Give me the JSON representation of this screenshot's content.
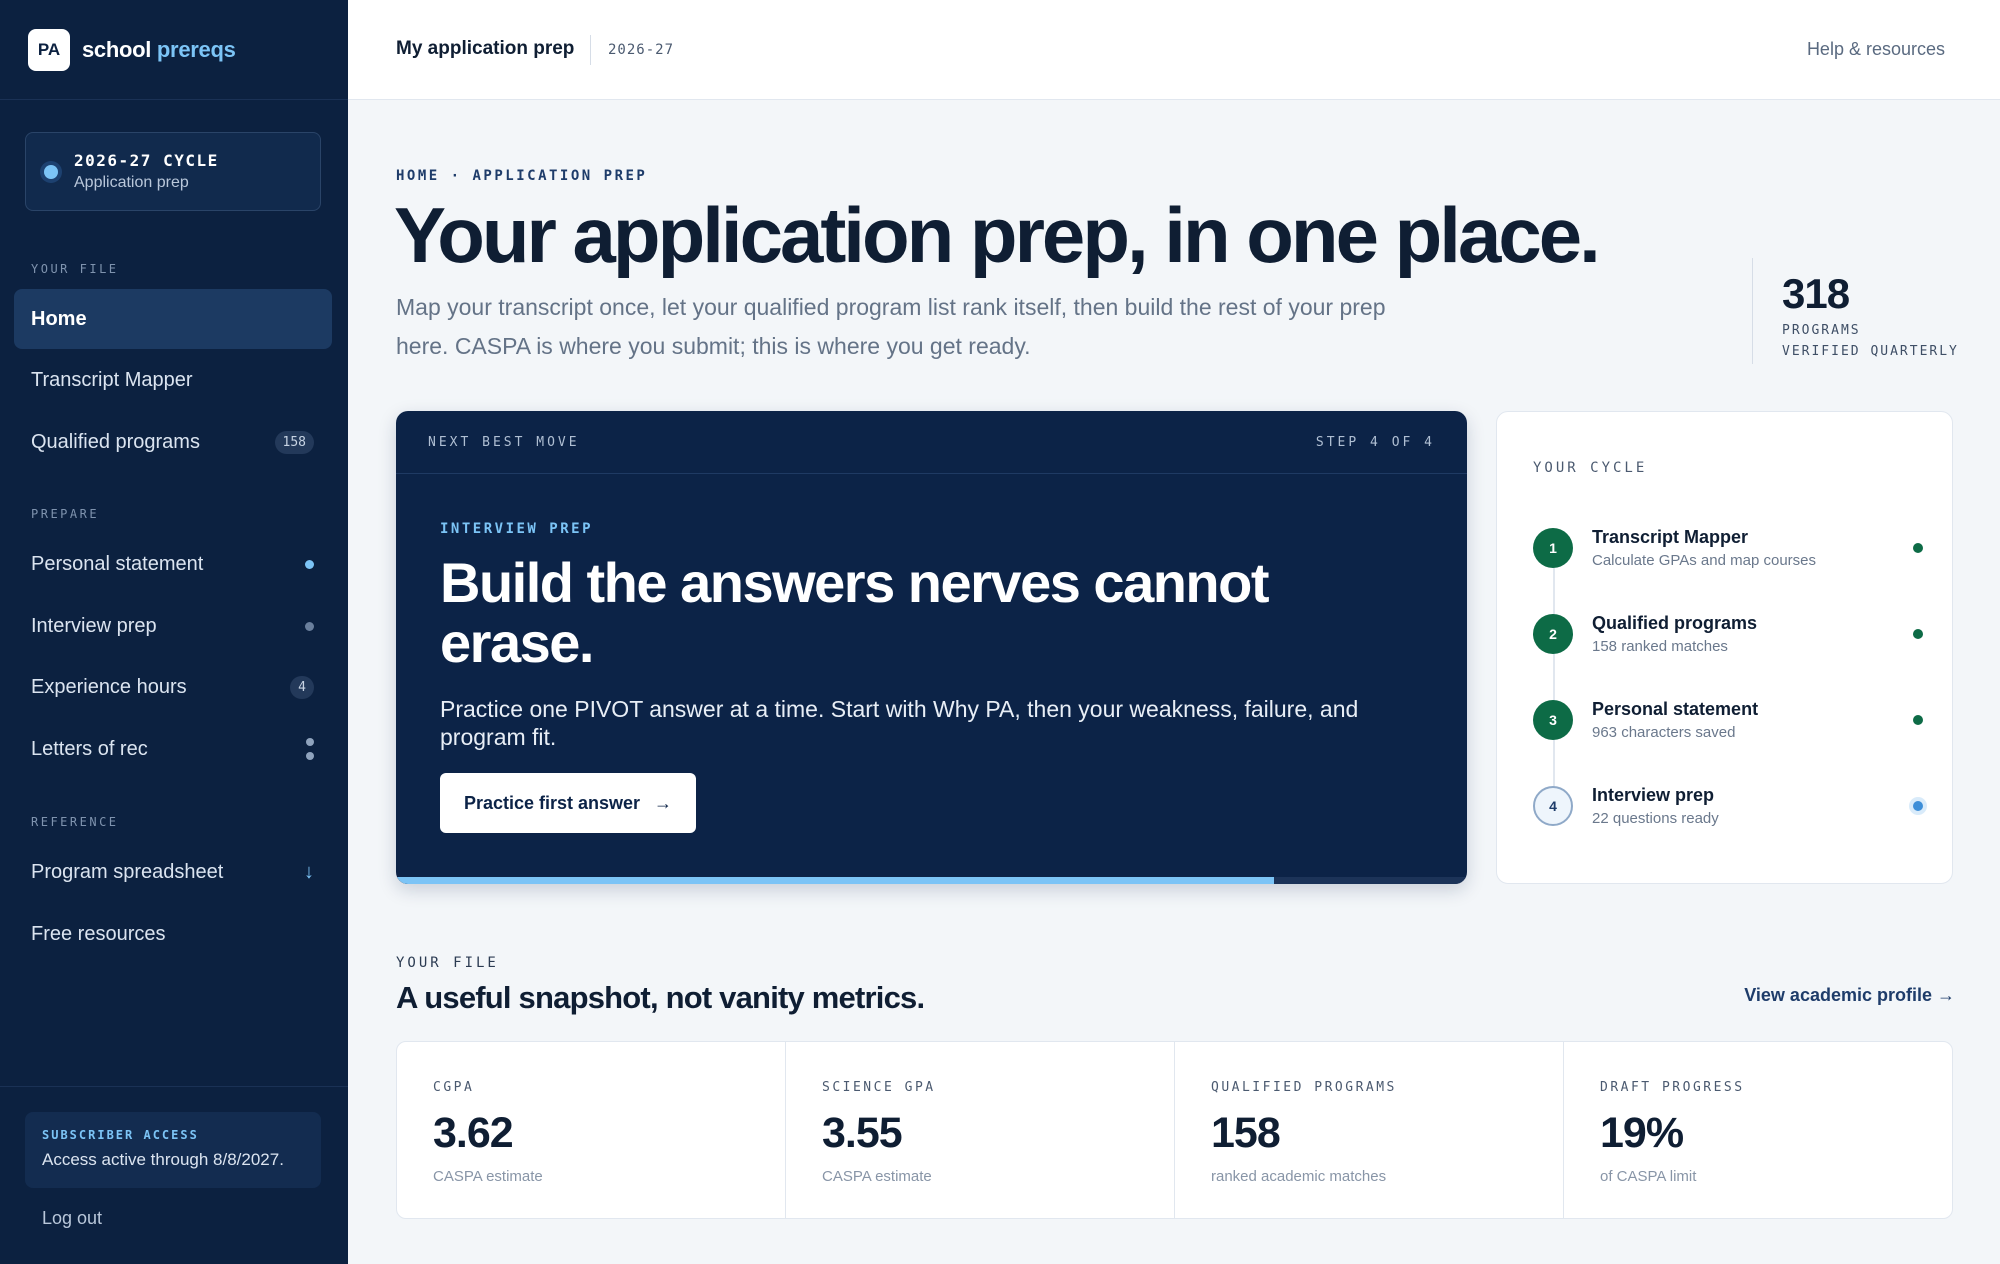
{
  "brand": {
    "logo": "PA",
    "name_main": "school",
    "name_accent": "prereqs"
  },
  "cycle": {
    "title": "2026-27 CYCLE",
    "subtitle": "Application prep"
  },
  "sidebar": {
    "sections": {
      "your_file": "YOUR FILE",
      "prepare": "PREPARE",
      "reference": "REFERENCE"
    },
    "items": [
      {
        "label": "Home"
      },
      {
        "label": "Transcript Mapper"
      },
      {
        "label": "Qualified programs",
        "badge": "158"
      },
      {
        "label": "Personal statement"
      },
      {
        "label": "Interview prep"
      },
      {
        "label": "Experience hours",
        "badge": "4"
      },
      {
        "label": "Letters of rec"
      },
      {
        "label": "Program spreadsheet",
        "icon": "download-arrow-icon"
      },
      {
        "label": "Free resources"
      }
    ],
    "access": {
      "title": "SUBSCRIBER ACCESS",
      "text": "Access active through 8/8/2027."
    },
    "logout": "Log out"
  },
  "topbar": {
    "title": "My application prep",
    "cycle": "2026-27",
    "help": "Help & resources"
  },
  "hero": {
    "breadcrumb": "HOME · APPLICATION PREP",
    "title": "Your application prep, in one place.",
    "subtitle": "Map your transcript once, let your qualified program list rank itself, then build the rest of your prep here. CASPA is where you submit; this is where you get ready.",
    "stat_value": "318",
    "stat_label_1": "PROGRAMS",
    "stat_label_2": "VERIFIED QUARTERLY"
  },
  "next_move": {
    "header": "NEXT BEST MOVE",
    "step": "STEP 4 OF 4",
    "kicker": "INTERVIEW PREP",
    "title": "Build the answers nerves cannot erase.",
    "description": "Practice one PIVOT answer at a time. Start with Why PA, then your weakness, failure, and program fit.",
    "button": "Practice first answer",
    "button_arrow": "→",
    "progress_fraction": 0.82
  },
  "your_cycle": {
    "label": "YOUR CYCLE",
    "steps": [
      {
        "num": "1",
        "title": "Transcript Mapper",
        "sub": "Calculate GPAs and map courses",
        "state": "done"
      },
      {
        "num": "2",
        "title": "Qualified programs",
        "sub": "158 ranked matches",
        "state": "done"
      },
      {
        "num": "3",
        "title": "Personal statement",
        "sub": "963 characters saved",
        "state": "done"
      },
      {
        "num": "4",
        "title": "Interview prep",
        "sub": "22 questions ready",
        "state": "current"
      }
    ]
  },
  "file": {
    "label": "YOUR FILE",
    "title": "A useful snapshot, not vanity metrics.",
    "link": "View academic profile →",
    "metrics": [
      {
        "label": "CGPA",
        "value": "3.62",
        "note": "CASPA estimate"
      },
      {
        "label": "SCIENCE GPA",
        "value": "3.55",
        "note": "CASPA estimate"
      },
      {
        "label": "QUALIFIED PROGRAMS",
        "value": "158",
        "note": "ranked academic matches"
      },
      {
        "label": "DRAFT PROGRESS",
        "value": "19%",
        "note": "of CASPA limit"
      }
    ]
  },
  "colors": {
    "sidebar_bg": "#0c2140",
    "accent": "#7cc4f6",
    "done_green": "#0d6b46",
    "card_bg": "#0c2347"
  }
}
